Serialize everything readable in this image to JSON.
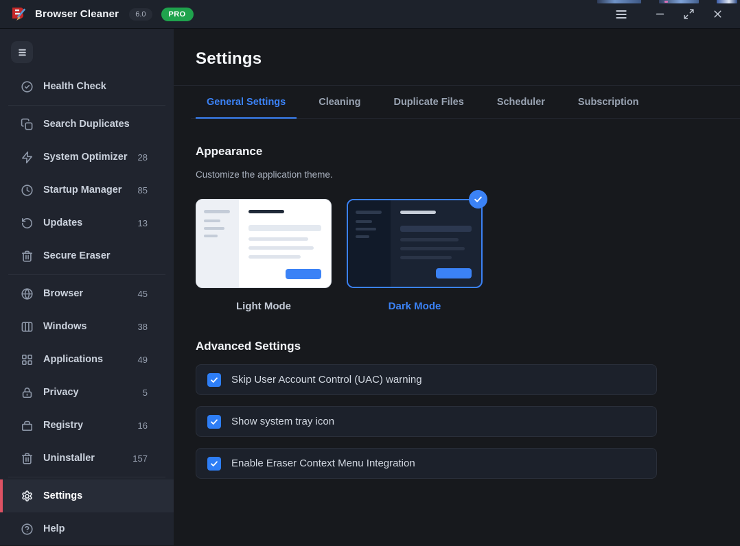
{
  "titlebar": {
    "app_name": "Browser Cleaner",
    "version_badge": "6.0",
    "plan_badge": "PRO",
    "window_controls": [
      {
        "icon": "menu"
      },
      {
        "icon": "minimize"
      },
      {
        "icon": "maximize"
      },
      {
        "icon": "close"
      }
    ]
  },
  "sidebar": {
    "sections": [
      {
        "items": [
          {
            "icon": "check-circle",
            "label": "Health Check"
          }
        ]
      },
      {
        "items": [
          {
            "icon": "copy",
            "label": "Search Duplicates"
          },
          {
            "icon": "zap",
            "label": "System Optimizer",
            "count": "28"
          },
          {
            "icon": "clock",
            "label": "Startup Manager",
            "count": "85"
          },
          {
            "icon": "refresh",
            "label": "Updates",
            "count": "13"
          },
          {
            "icon": "trash",
            "label": "Secure Eraser"
          }
        ]
      },
      {
        "items": [
          {
            "icon": "globe",
            "label": "Browser",
            "count": "45"
          },
          {
            "icon": "columns",
            "label": "Windows",
            "count": "38"
          },
          {
            "icon": "grid",
            "label": "Applications",
            "count": "49"
          },
          {
            "icon": "lock",
            "label": "Privacy",
            "count": "5"
          },
          {
            "icon": "archive",
            "label": "Registry",
            "count": "16"
          },
          {
            "icon": "trash",
            "label": "Uninstaller",
            "count": "157"
          }
        ]
      },
      {
        "items": [
          {
            "icon": "gear",
            "label": "Settings",
            "active": true
          },
          {
            "icon": "help-circle",
            "label": "Help"
          }
        ]
      }
    ]
  },
  "main": {
    "page_title": "Settings",
    "tabs": [
      {
        "label": "General Settings",
        "active": true
      },
      {
        "label": "Cleaning"
      },
      {
        "label": "Duplicate Files"
      },
      {
        "label": "Scheduler"
      },
      {
        "label": "Subscription"
      }
    ],
    "appearance": {
      "title": "Appearance",
      "description": "Customize the application theme.",
      "themes": [
        {
          "label": "Light Mode",
          "variant": "light",
          "selected": false
        },
        {
          "label": "Dark Mode",
          "variant": "dark",
          "selected": true
        }
      ]
    },
    "advanced": {
      "title": "Advanced Settings",
      "options": [
        {
          "label": "Skip User Account Control (UAC) warning",
          "checked": true
        },
        {
          "label": "Show system tray icon",
          "checked": true
        },
        {
          "label": "Enable Eraser Context Menu Integration",
          "checked": true
        }
      ]
    }
  },
  "colors": {
    "accent": "#3b82f6",
    "active_item_marker": "#dd5263",
    "pro_badge": "#1fa34d",
    "sidebar_bg": "#20242e",
    "main_bg": "#17191d"
  }
}
